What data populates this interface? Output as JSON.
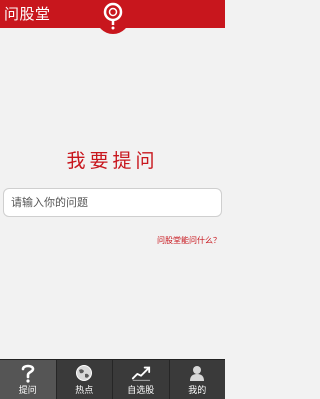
{
  "header": {
    "title": "问股堂",
    "logo_icon": "question-mark-logo-icon"
  },
  "main": {
    "heading": "我要提问",
    "question_input": {
      "placeholder": "请输入你的问题",
      "value": ""
    },
    "help_link": "问股堂能问什么？"
  },
  "tabbar": {
    "active_index": 0,
    "tabs": [
      {
        "label": "提问",
        "icon": "question-icon"
      },
      {
        "label": "热点",
        "icon": "globe-icon"
      },
      {
        "label": "自选股",
        "icon": "trend-chart-icon"
      },
      {
        "label": "我的",
        "icon": "user-icon"
      }
    ]
  },
  "colors": {
    "brand_red": "#c8161d",
    "tabbar_bg": "#3a3a3a",
    "tab_active_bg": "#555555",
    "page_bg": "#f2f2f2"
  }
}
